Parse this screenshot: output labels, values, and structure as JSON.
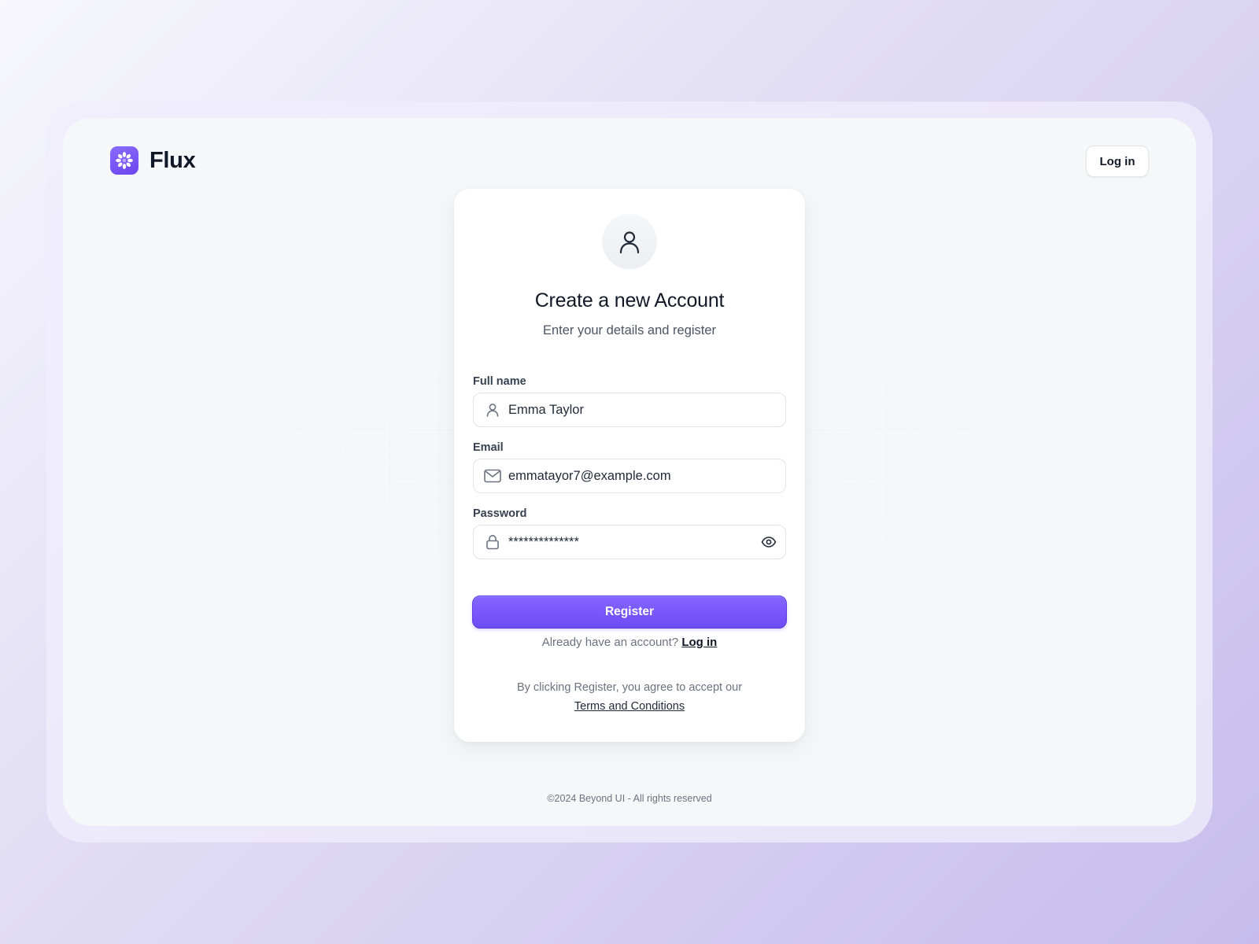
{
  "brand": {
    "name": "Flux",
    "accent_color": "#7c5cfc",
    "logo_icon": "asterisk-flower-icon"
  },
  "header": {
    "login_label": "Log in"
  },
  "card": {
    "avatar_icon": "user-icon",
    "title": "Create a new Account",
    "subtitle": "Enter your details and register"
  },
  "form": {
    "full_name": {
      "label": "Full name",
      "value": "Emma Taylor",
      "icon": "user-icon"
    },
    "email": {
      "label": "Email",
      "value": "emmatayor7@example.com",
      "icon": "mail-icon"
    },
    "password": {
      "label": "Password",
      "value": "**************",
      "icon": "lock-icon",
      "toggle_icon": "eye-icon"
    },
    "register_label": "Register"
  },
  "login_prompt": {
    "text": "Already have an account?",
    "link": "Log in"
  },
  "terms": {
    "text": "By clicking Register, you agree to accept our",
    "link": "Terms and Conditions"
  },
  "footer": {
    "copyright": "©2024 Beyond UI - All rights reserved"
  }
}
